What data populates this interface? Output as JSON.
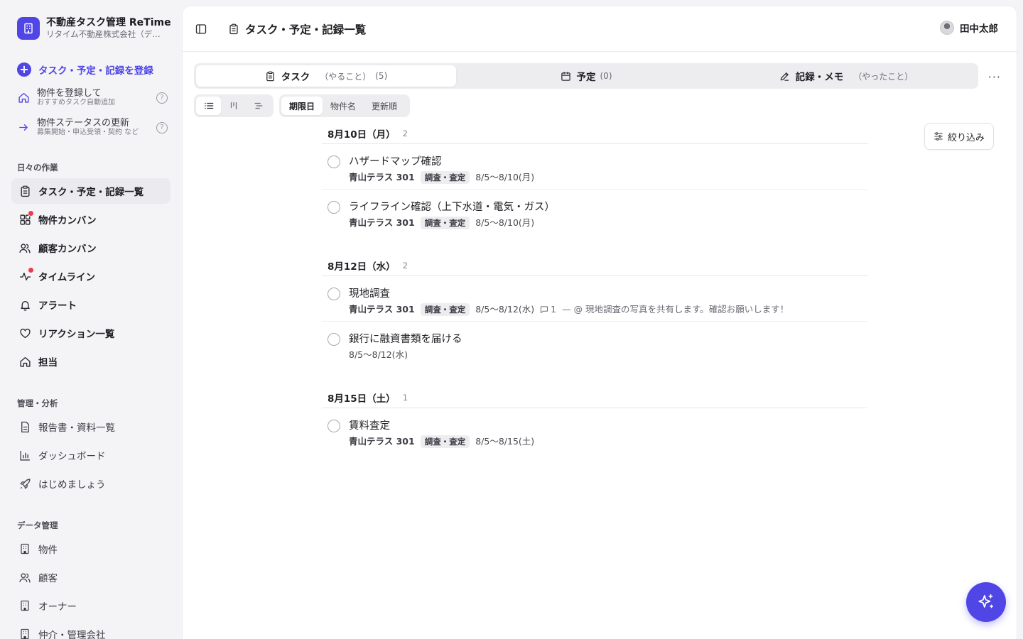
{
  "brand": {
    "title": "不動産タスク管理 ReTime",
    "subtitle": "リタイム不動産株式会社（デ…"
  },
  "sidebar": {
    "register_label": "タスク・予定・記録を登録",
    "quick": [
      {
        "title": "物件を登録して",
        "sub": "おすすめタスク自動追加",
        "icon": "home-icon"
      },
      {
        "title": "物件ステータスの更新",
        "sub": "募集開始・申込受領・契約 など",
        "icon": "arrow-right-icon"
      }
    ],
    "sections": {
      "daily": "日々の作業",
      "manage": "管理・分析",
      "data": "データ管理"
    },
    "daily_items": [
      {
        "label": "タスク・予定・記録一覧",
        "icon": "clipboard-icon",
        "active": true
      },
      {
        "label": "物件カンバン",
        "icon": "grid-icon",
        "dot": true
      },
      {
        "label": "顧客カンバン",
        "icon": "users-icon"
      },
      {
        "label": "タイムライン",
        "icon": "activity-icon",
        "dot": true
      },
      {
        "label": "アラート",
        "icon": "bell-icon"
      },
      {
        "label": "リアクション一覧",
        "icon": "heart-icon"
      },
      {
        "label": "担当",
        "icon": "home-icon"
      }
    ],
    "manage_items": [
      {
        "label": "報告書・資料一覧",
        "icon": "document-icon"
      },
      {
        "label": "ダッシュボード",
        "icon": "bar-chart-icon"
      },
      {
        "label": "はじめましょう",
        "icon": "rocket-icon"
      }
    ],
    "data_items": [
      {
        "label": "物件",
        "icon": "building-icon"
      },
      {
        "label": "顧客",
        "icon": "users-icon"
      },
      {
        "label": "オーナー",
        "icon": "building-icon"
      },
      {
        "label": "仲介・管理会社",
        "icon": "building-icon"
      }
    ]
  },
  "header": {
    "title": "タスク・予定・記録一覧",
    "user": "田中太郎"
  },
  "tabs": [
    {
      "label": "タスク",
      "sub": "（やること）",
      "count": "(5)",
      "active": true
    },
    {
      "label": "予定",
      "sub": "",
      "count": "(0)"
    },
    {
      "label": "記録・メモ",
      "sub": "（やったこと）",
      "count": ""
    }
  ],
  "sort": [
    "期限日",
    "物件名",
    "更新順"
  ],
  "filter_label": "絞り込み",
  "groups": [
    {
      "date": "8月10日（月）",
      "count": "2",
      "tasks": [
        {
          "title": "ハザードマップ確認",
          "property": "青山テラス 301",
          "badge": "調査・査定",
          "range": "8/5〜8/10(月)"
        },
        {
          "title": "ライフライン確認（上下水道・電気・ガス）",
          "property": "青山テラス 301",
          "badge": "調査・査定",
          "range": "8/5〜8/10(月)"
        }
      ]
    },
    {
      "date": "8月12日（水）",
      "count": "2",
      "tasks": [
        {
          "title": "現地調査",
          "property": "青山テラス 301",
          "badge": "調査・査定",
          "range": "8/5〜8/12(水)",
          "comments": "1",
          "preview": "— @ 現地調査の写真を共有します。確認お願いします！"
        },
        {
          "title": "銀行に融資書類を届ける",
          "property": "",
          "badge": "",
          "range": "8/5〜8/12(水)"
        }
      ]
    },
    {
      "date": "8月15日（土）",
      "count": "1",
      "tasks": [
        {
          "title": "賃料査定",
          "property": "青山テラス 301",
          "badge": "調査・査定",
          "range": "8/5〜8/15(土)"
        }
      ]
    }
  ],
  "colors": {
    "accent": "#4f46e5",
    "notification": "#ef3b4b"
  }
}
